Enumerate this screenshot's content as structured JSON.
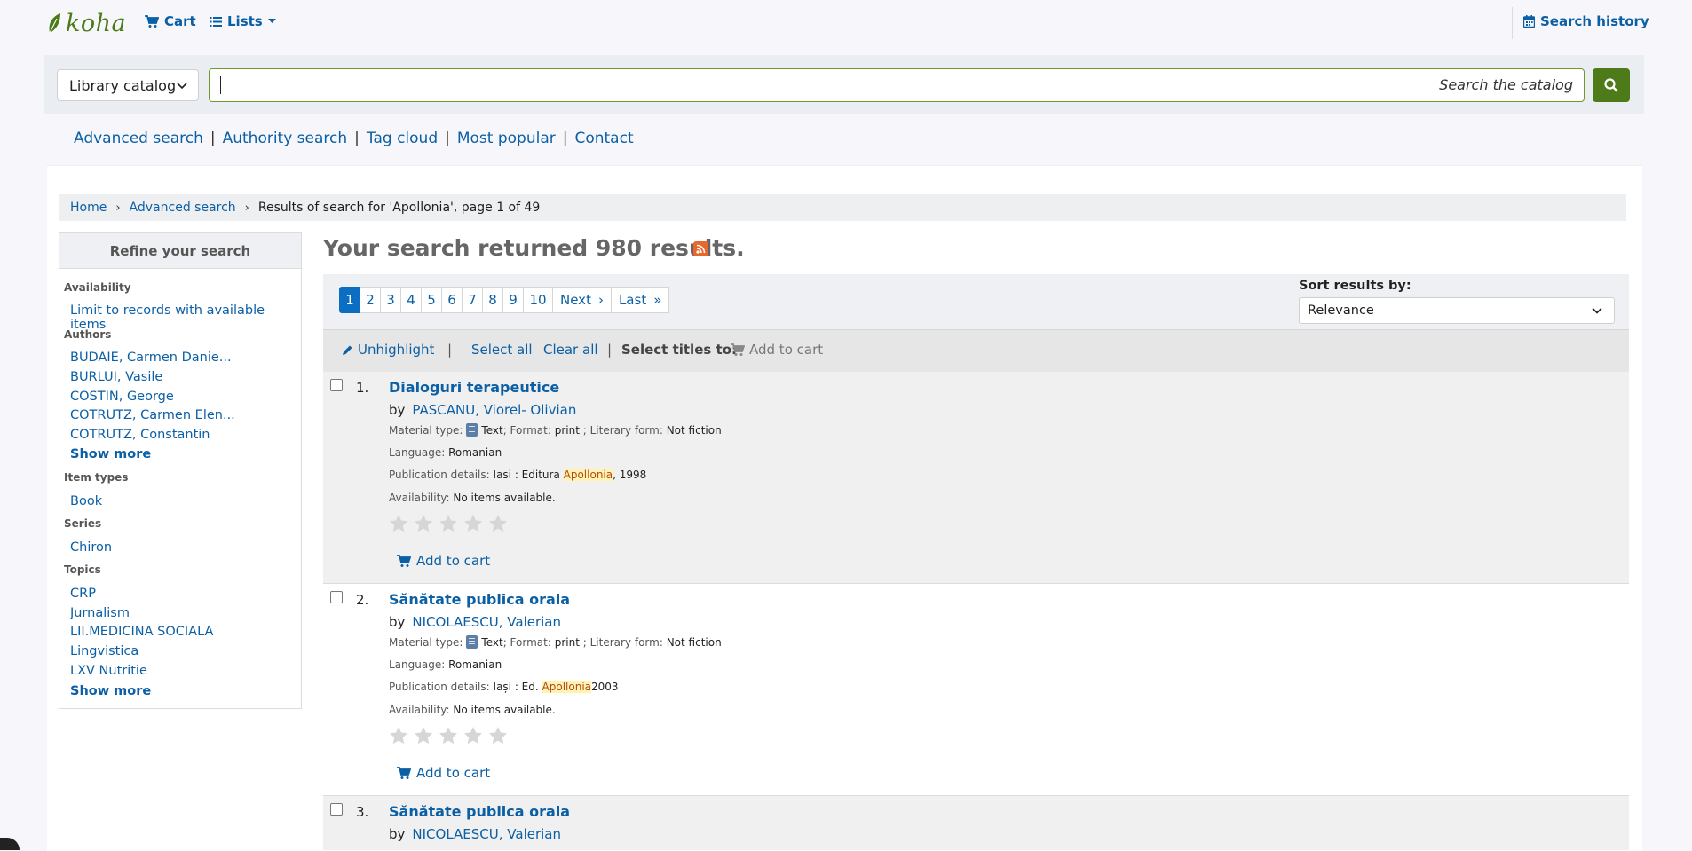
{
  "header": {
    "logo": "koha",
    "cart": "Cart",
    "lists": "Lists",
    "search_history": "Search history"
  },
  "search": {
    "catalog_select": "Library catalog",
    "placeholder": "Search the catalog",
    "value": ""
  },
  "nav": {
    "links": [
      "Advanced search",
      "Authority search",
      "Tag cloud",
      "Most popular",
      "Contact"
    ]
  },
  "breadcrumb": {
    "home": "Home",
    "advanced": "Advanced search",
    "current": "Results of search for 'Apollonia', page 1 of 49"
  },
  "facets": {
    "heading": "Refine your search",
    "availability_title": "Availability",
    "availability_item": "Limit to records with available items",
    "authors_title": "Authors",
    "authors": [
      "BUDAIE, Carmen Danie...",
      "BURLUI, Vasile",
      "COSTIN, George",
      "COTRUTZ, Carmen Elen...",
      "COTRUTZ, Constantin"
    ],
    "show_more": "Show more",
    "itemtypes_title": "Item types",
    "itemtypes": [
      "Book"
    ],
    "series_title": "Series",
    "series": [
      "Chiron"
    ],
    "topics_title": "Topics",
    "topics": [
      "CRP",
      "Jurnalism",
      "LII.MEDICINA SOCIALA",
      "Lingvistica",
      "LXV Nutritie"
    ]
  },
  "results": {
    "heading": "Your search returned 980 results.",
    "pages": [
      "1",
      "2",
      "3",
      "4",
      "5",
      "6",
      "7",
      "8",
      "9",
      "10"
    ],
    "next": "Next",
    "last": "Last",
    "sort_label": "Sort results by:",
    "sort_value": "Relevance",
    "toolbar": {
      "unhighlight": "Unhighlight",
      "select_all": "Select all",
      "clear_all": "Clear all",
      "select_titles": "Select titles to:",
      "add_to_cart": "Add to cart"
    },
    "labels": {
      "by": "by",
      "material_type": "Material type:",
      "format": "; Format:",
      "literary_form": "; Literary form:",
      "language": "Language:",
      "publication": "Publication details:",
      "availability": "Availability:",
      "add_to_cart": "Add to cart"
    },
    "records": [
      {
        "num": "1.",
        "title": "Dialoguri terapeutice",
        "author": "PASCANU, Viorel- Olivian",
        "material": "Text",
        "format": "print",
        "literary_form": "Not fiction",
        "language": "Romanian",
        "pub_pre": "Iasi : Editura",
        "pub_hl": "Apollonia",
        "pub_post": ", 1998",
        "availability": "No items available."
      },
      {
        "num": "2.",
        "title": "Sănătate publica orala",
        "author": "NICOLAESCU, Valerian",
        "material": "Text",
        "format": "print",
        "literary_form": "Not fiction",
        "language": "Romanian",
        "pub_pre": "Iași : Ed.",
        "pub_hl": "Apollonia",
        "pub_post": " 2003",
        "availability": "No items available."
      },
      {
        "num": "3.",
        "title": "Sănătate publica orala",
        "author": "NICOLAESCU, Valerian"
      }
    ]
  },
  "colors": {
    "link": "#0b5fa5",
    "brand_green": "#4e7b1a",
    "highlight": "#fff3b0",
    "active_page": "#0b6ec2"
  }
}
